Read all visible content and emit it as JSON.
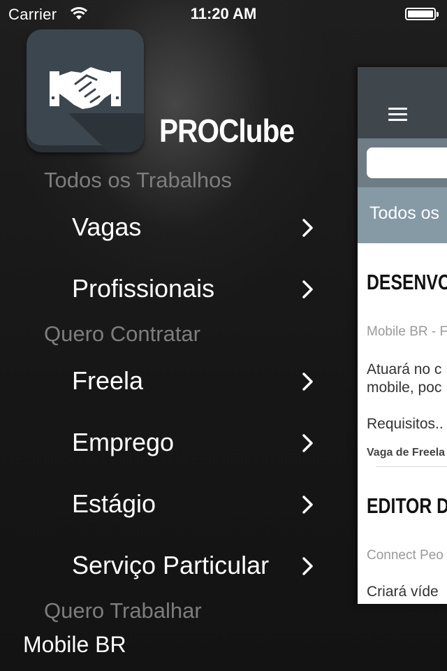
{
  "status_bar": {
    "carrier": "Carrier",
    "time": "11:20 AM"
  },
  "app": {
    "title": "PROClube",
    "logo_icon": "handshake-icon"
  },
  "menu": {
    "sections": [
      {
        "header": "Todos os Trabalhos",
        "items": [
          {
            "label": "Vagas"
          },
          {
            "label": "Profissionais"
          }
        ]
      },
      {
        "header": "Quero Contratar",
        "items": [
          {
            "label": "Freela"
          },
          {
            "label": "Emprego"
          },
          {
            "label": "Estágio"
          },
          {
            "label": "Serviço Particular"
          }
        ]
      },
      {
        "header": "Quero Trabalhar",
        "items": []
      }
    ],
    "footer_item": "Mobile BR"
  },
  "preview": {
    "tab_label": "Todos os",
    "cards": [
      {
        "title": "DESENVO",
        "company": "Mobile BR - F",
        "desc_line1": "Atuará no c",
        "desc_line2": "mobile, poc",
        "requirements": "Requisitos..",
        "type": "Vaga de Freela"
      },
      {
        "title": "EDITOR D",
        "company": "Connect Peo",
        "desc_line1": "Criará víde"
      }
    ]
  },
  "colors": {
    "background": "#161616",
    "section_header": "#7d7d7d",
    "nav_bar": "#3f474d",
    "search_bar": "#6d7c85",
    "tab_bar": "#869aa6",
    "logo_face": "#3c464e"
  }
}
